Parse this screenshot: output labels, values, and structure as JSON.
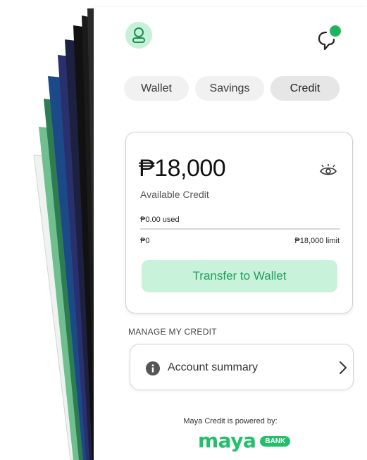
{
  "tabs": [
    {
      "label": "Wallet",
      "active": false
    },
    {
      "label": "Savings",
      "active": false
    },
    {
      "label": "Credit",
      "active": true
    }
  ],
  "credit": {
    "amount": "₱18,000",
    "available_label": "Available Credit",
    "used_label": "₱0.00 used",
    "min_label": "₱0",
    "limit_label": "₱18,000 limit",
    "used_fraction": 0,
    "transfer_label": "Transfer to Wallet"
  },
  "manage": {
    "section_title": "MANAGE MY CREDIT",
    "account_summary_label": "Account summary"
  },
  "footer": {
    "powered_by": "Maya Credit is powered by:",
    "brand": "maya",
    "brand_badge": "BANK"
  },
  "icons": {
    "profile": "profile-icon",
    "chat": "chat-icon",
    "eye": "eye-icon",
    "info": "info-icon",
    "chevron": "chevron-right-icon"
  },
  "colors": {
    "accent_green": "#22c06b",
    "button_green_bg": "#c9f2db",
    "button_green_text": "#1f9e5f",
    "notification_dot": "#1fb55c"
  }
}
